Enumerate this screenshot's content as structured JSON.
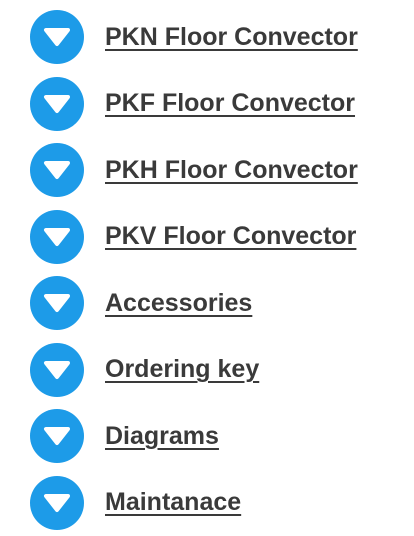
{
  "colors": {
    "icon_background": "#1d9be8",
    "icon_glyph": "#ffffff",
    "link_text": "#3a3a3a"
  },
  "nav": {
    "items": [
      {
        "label": "PKN Floor Convector",
        "icon": "chevron-down-icon"
      },
      {
        "label": "PKF Floor Convector",
        "icon": "chevron-down-icon"
      },
      {
        "label": "PKH Floor Convector",
        "icon": "chevron-down-icon"
      },
      {
        "label": "PKV Floor Convector",
        "icon": "chevron-down-icon"
      },
      {
        "label": "Accessories",
        "icon": "chevron-down-icon"
      },
      {
        "label": "Ordering key",
        "icon": "chevron-down-icon"
      },
      {
        "label": "Diagrams",
        "icon": "chevron-down-icon"
      },
      {
        "label": "Maintanace",
        "icon": "chevron-down-icon"
      }
    ]
  }
}
